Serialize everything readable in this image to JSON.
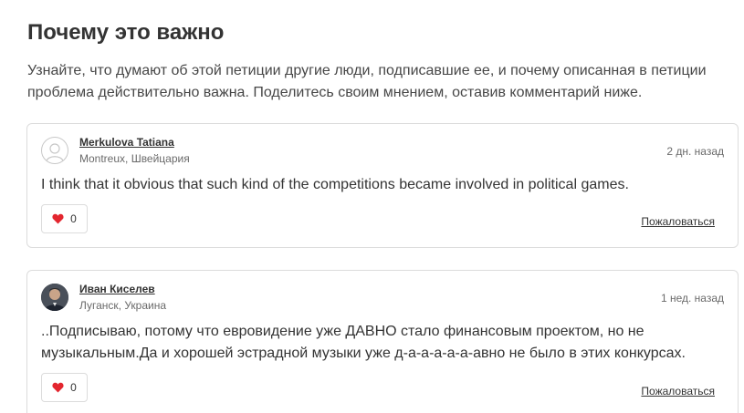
{
  "section": {
    "title": "Почему это важно",
    "description": "Узнайте, что думают об этой петиции другие люди, подписавшие ее, и почему описанная в петиции проблема действительно важна. Поделитесь своим мнением, оставив комментарий ниже."
  },
  "comments": [
    {
      "author": "Merkulova Tatiana",
      "location": "Montreux, Швейцария",
      "time": "2 дн. назад",
      "text": "I think that it obvious that such kind of the competitions became involved in political games.",
      "likes": "0",
      "report_label": "Пожаловаться",
      "avatar": "user-placeholder-icon"
    },
    {
      "author": "Иван Киселев",
      "location": "Луганск, Украина",
      "time": "1 нед. назад",
      "text": "..Подписываю, потому что евровидение уже ДАВНО стало финансовым проектом, но не музыкальным.Да и хорошей эстрадной музыки уже д-а-а-а-а-а-авно не было в этих конкурсах.",
      "likes": "0",
      "report_label": "Пожаловаться",
      "avatar": "profile-photo"
    }
  ],
  "colors": {
    "heart": "#e3262f",
    "border": "#dcdcdc",
    "text": "#333333",
    "muted": "#6a6a6a"
  }
}
